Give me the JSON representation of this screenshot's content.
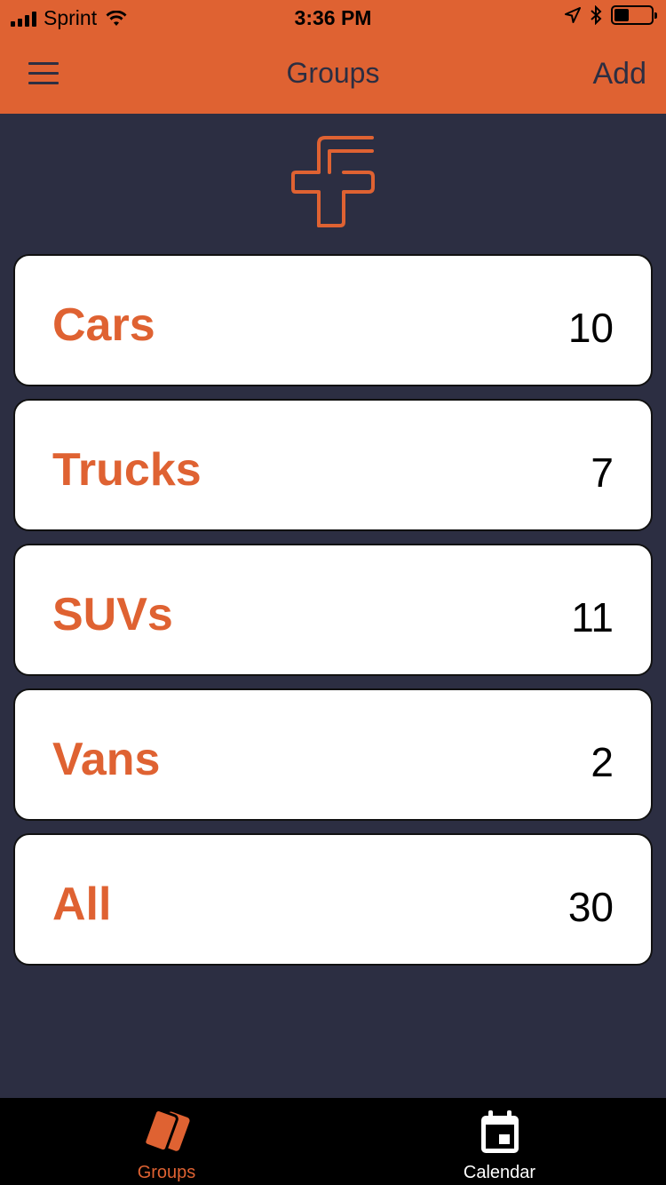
{
  "status_bar": {
    "carrier": "Sprint",
    "time": "3:36 PM",
    "signal_bars": 4,
    "battery_level": 0.4
  },
  "nav": {
    "title": "Groups",
    "add_label": "Add"
  },
  "colors": {
    "accent": "#df6232",
    "background": "#2c2e42",
    "card": "#ffffff",
    "tab_bar": "#000000"
  },
  "groups": [
    {
      "name": "Cars",
      "count": "10"
    },
    {
      "name": "Trucks",
      "count": "7"
    },
    {
      "name": "SUVs",
      "count": "11"
    },
    {
      "name": "Vans",
      "count": "2"
    },
    {
      "name": "All",
      "count": "30"
    }
  ],
  "tabs": [
    {
      "label": "Groups",
      "icon": "cards-icon",
      "active": true
    },
    {
      "label": "Calendar",
      "icon": "calendar-icon",
      "active": false
    }
  ]
}
